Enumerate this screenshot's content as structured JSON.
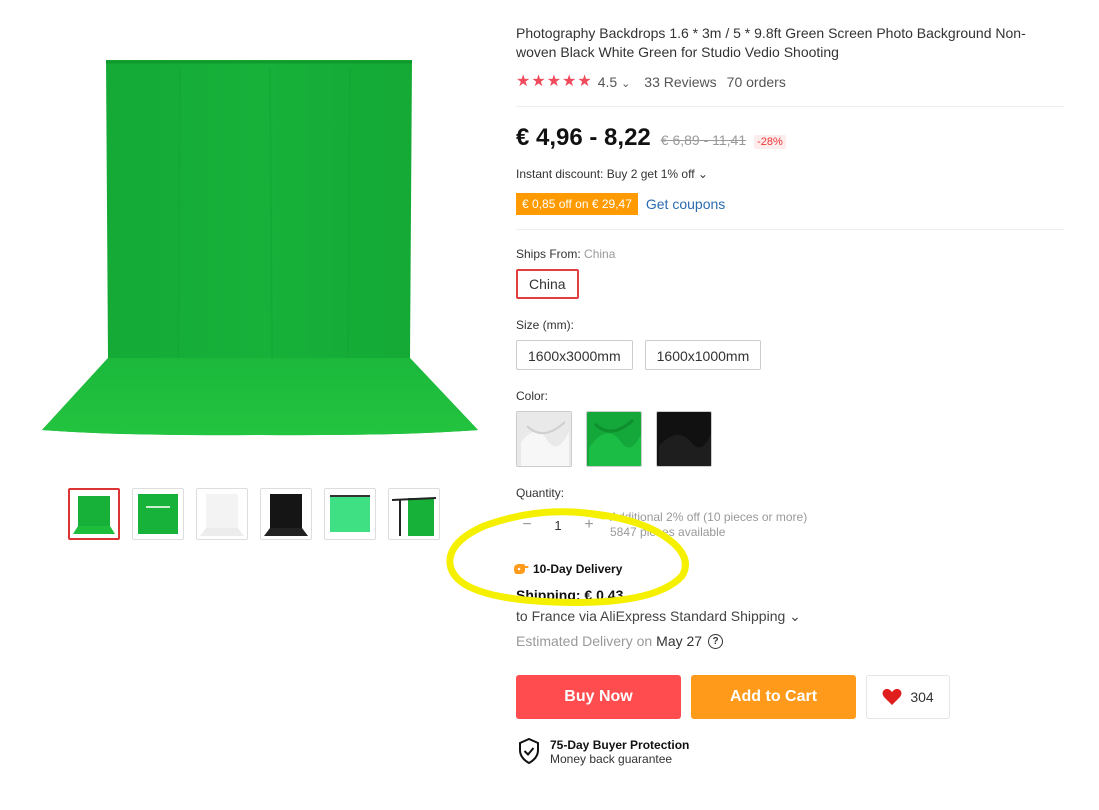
{
  "product": {
    "title": "Photography Backdrops 1.6 * 3m / 5 * 9.8ft Green Screen Photo Background Non-woven Black White Green for Studio Vedio Shooting",
    "rating": "4.5",
    "rating_caret": "⌄",
    "reviews": "33 Reviews",
    "orders": "70 orders",
    "price": "€ 4,96 - 8,22",
    "old_price": "€ 6,89 - 11,41",
    "discount": "-28%",
    "instant_discount": "Instant discount: Buy 2 get 1% off ⌄",
    "coupon_badge": "€ 0,85 off on € 29,47",
    "get_coupons": "Get coupons"
  },
  "ships_from": {
    "label": "Ships From:",
    "current": "China",
    "options": [
      "China"
    ]
  },
  "size": {
    "label": "Size (mm):",
    "options": [
      "1600x3000mm",
      "1600x1000mm"
    ]
  },
  "color": {
    "label": "Color:",
    "swatches": [
      "white",
      "green",
      "black"
    ]
  },
  "quantity": {
    "label": "Quantity:",
    "minus": "−",
    "value": "1",
    "plus": "+",
    "info_line1": "Additional 2% off (10 pieces or more)",
    "info_line2": "5847 pieces available"
  },
  "delivery": {
    "badge": "10-Day Delivery",
    "shipping": "Shipping: € 0,43",
    "ship_to": "to France via AliExpress Standard Shipping ⌄",
    "est_label": "Estimated Delivery on",
    "est_date": "May 27",
    "help_icon": "?"
  },
  "actions": {
    "buy_now": "Buy Now",
    "add_to_cart": "Add to Cart",
    "wishlist_count": "304"
  },
  "protection": {
    "title": "75-Day Buyer Protection",
    "subtitle": "Money back guarantee"
  },
  "colors": {
    "accent_red": "#ff4d4f",
    "accent_orange": "#ff9a1a",
    "star": "#f04a5c",
    "green_screen": "#1dbb3a",
    "annotation_yellow": "#f5f000"
  }
}
